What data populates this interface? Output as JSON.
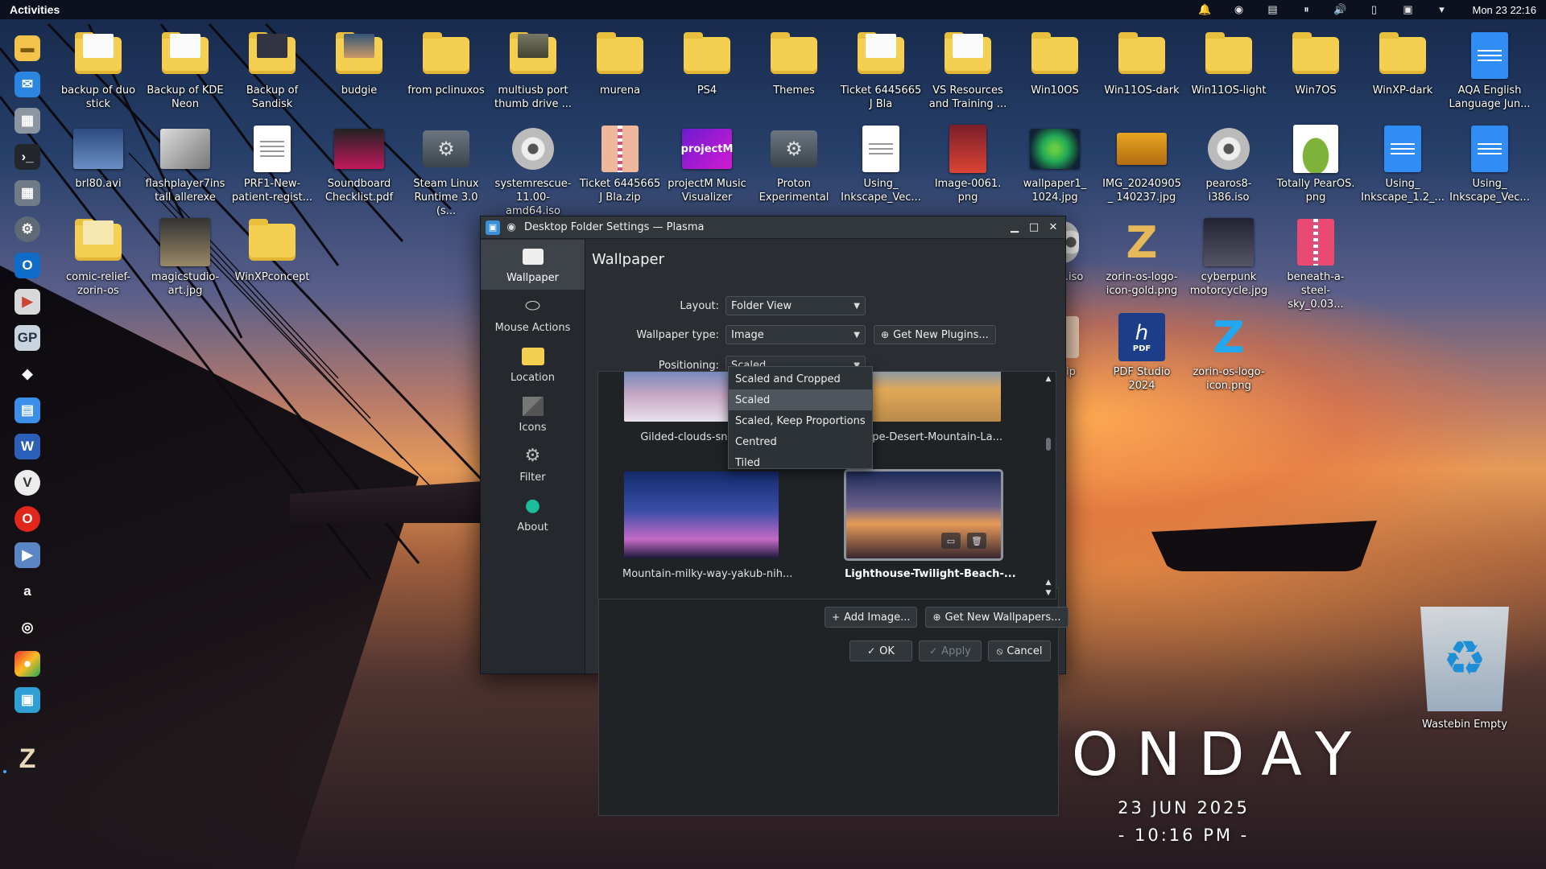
{
  "topbar": {
    "activities": "Activities",
    "clock": "Mon 23 22:16"
  },
  "desktop": {
    "icons": [
      {
        "label": "backup of duo stick"
      },
      {
        "label": "Backup of KDE Neon"
      },
      {
        "label": "Backup of Sandisk"
      },
      {
        "label": "budgie"
      },
      {
        "label": "from pclinuxos"
      },
      {
        "label": "multiusb port thumb drive ..."
      },
      {
        "label": "murena"
      },
      {
        "label": "PS4"
      },
      {
        "label": "Themes"
      },
      {
        "label": "Ticket 6445665 J Bla"
      },
      {
        "label": "VS Resources and Training ..."
      },
      {
        "label": "Win10OS"
      },
      {
        "label": "Win11OS-dark"
      },
      {
        "label": "Win11OS-light"
      },
      {
        "label": "Win7OS"
      },
      {
        "label": "WinXP-dark"
      },
      {
        "label": "AQA English Language Jun..."
      },
      {
        "label": "brl80.avi"
      },
      {
        "label": "flashplayer7install allerexe"
      },
      {
        "label": "PRF1-New-patient-regist..."
      },
      {
        "label": "Soundboard Checklist.pdf"
      },
      {
        "label": "Steam Linux Runtime 3.0 (s..."
      },
      {
        "label": "systemrescue-11.00-amd64.iso"
      },
      {
        "label": "Ticket 6445665 J Bla.zip"
      },
      {
        "label": "projectM Music Visualizer"
      },
      {
        "label": "Proton Experimental"
      },
      {
        "label": "Using_ Inkscape_Vec..."
      },
      {
        "label": "Image-0061. png"
      },
      {
        "label": "wallpaper1_ 1024.jpg"
      },
      {
        "label": "IMG_20240905_ 140237.jpg"
      },
      {
        "label": "pearos8-i386.iso"
      },
      {
        "label": "Totally PearOS. png"
      },
      {
        "label": "Using_ Inkscape_1.2_..."
      },
      {
        "label": "Using_ Inkscape_Vec..."
      },
      {
        "label": "comic-relief-zorin-os"
      },
      {
        "label": "magicstudio-art.jpg"
      },
      {
        "label": "WinXPconcept"
      },
      {
        "label": "4.iso"
      },
      {
        "label": "zorin-os-logo-icon-gold.png"
      },
      {
        "label": "cyberpunk motorcycle.jpg"
      },
      {
        "label": "beneath-a-steel-sky_0.03..."
      },
      {
        "label": "ip"
      },
      {
        "label": "PDF Studio 2024"
      },
      {
        "label": "zorin-os-logo-icon.png"
      }
    ],
    "trash_label": "Wastebin Empty",
    "pdf_badge": "PDF",
    "projectm_badge": "projectM"
  },
  "clock_widget": {
    "day": "MONDAY",
    "date": "23 JUN 2025",
    "time": "- 10:16 PM -"
  },
  "dialog": {
    "title": "Desktop Folder Settings — Plasma",
    "sidebar": [
      {
        "label": "Wallpaper",
        "icon": "wallpaper-icon"
      },
      {
        "label": "Mouse Actions",
        "icon": "mouse-icon"
      },
      {
        "label": "Location",
        "icon": "folder-icon"
      },
      {
        "label": "Icons",
        "icon": "icons-icon"
      },
      {
        "label": "Filter",
        "icon": "filter-icon"
      },
      {
        "label": "About",
        "icon": "about-icon"
      }
    ],
    "section_title": "Wallpaper",
    "layout_label": "Layout:",
    "layout_value": "Folder View",
    "wallpaper_type_label": "Wallpaper type:",
    "wallpaper_type_value": "Image",
    "get_new_plugins": "Get New Plugins...",
    "positioning_label": "Positioning:",
    "positioning_value": "Scaled",
    "positioning_options": [
      "Scaled and Cropped",
      "Scaled",
      "Scaled, Keep Proportions",
      "Centred",
      "Tiled"
    ],
    "positioning_selected_index": 1,
    "wallpapers": [
      {
        "label": "Gilded-clouds-snowy-..."
      },
      {
        "label": "...scape-Desert-Mountain-La..."
      },
      {
        "label": "Mountain-milky-way-yakub-nih..."
      },
      {
        "label": "Lighthouse-Twilight-Beach-..."
      }
    ],
    "add_image": "Add Image...",
    "get_new_wallpapers": "Get New Wallpapers...",
    "ok": "OK",
    "apply": "Apply",
    "cancel": "Cancel"
  },
  "colors": {
    "accent": "#3daee9",
    "folder": "#f5cf50",
    "dialog_bg": "#2a2e32"
  }
}
